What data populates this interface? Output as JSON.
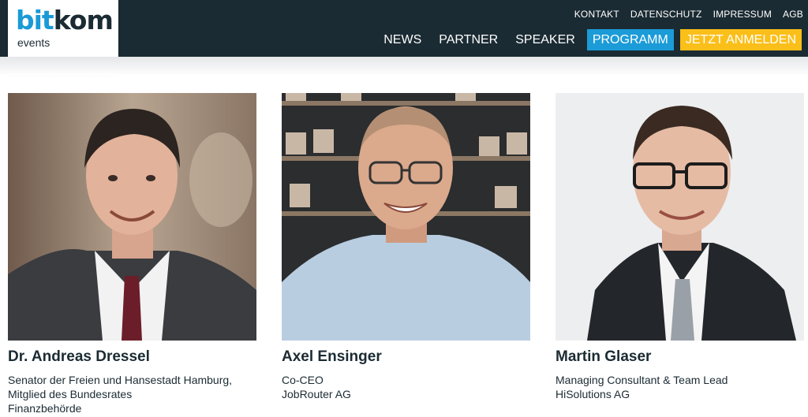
{
  "logo": {
    "brand_part1": "bit",
    "brand_part2": "kom",
    "sub": "events"
  },
  "topnav": [
    "KONTAKT",
    "DATENSCHUTZ",
    "IMPRESSUM",
    "AGB"
  ],
  "mainnav": {
    "news": "NEWS",
    "partner": "PARTNER",
    "speaker": "SPEAKER",
    "programm": "PROGRAMM",
    "anmelden": "JETZT ANMELDEN"
  },
  "colors": {
    "header_bg": "#1b2b33",
    "accent_blue": "#1b9bd7",
    "accent_yellow": "#fbbf1a"
  },
  "speakers": [
    {
      "name": "Dr. Andreas Dressel",
      "role1": "Senator der Freien und Hansestadt Hamburg,",
      "role2": "Mitglied des Bundesrates",
      "role3": "Finanzbehörde"
    },
    {
      "name": "Axel Ensinger",
      "role1": "Co-CEO",
      "role2": "JobRouter AG",
      "role3": ""
    },
    {
      "name": "Martin Glaser",
      "role1": "Managing Consultant & Team Lead",
      "role2": "HiSolutions AG",
      "role3": ""
    }
  ]
}
